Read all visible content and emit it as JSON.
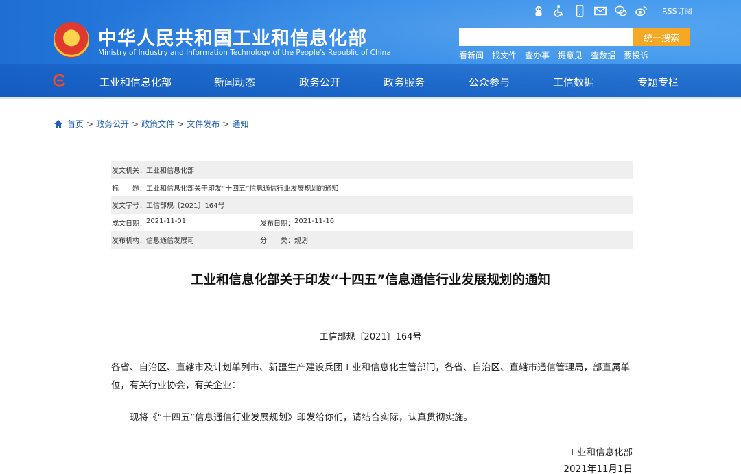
{
  "header": {
    "title": "中华人民共和国工业和信息化部",
    "subtitle": "Ministry of Industry and Information Technology of the People's Republic of China",
    "rss_label": "RSS订阅",
    "icons": [
      "robot-icon",
      "accessibility-icon",
      "mobile-icon",
      "mail-icon",
      "wechat-icon",
      "weibo-icon"
    ],
    "search": {
      "placeholder": "",
      "button_label": "统一搜索"
    },
    "quick_links": [
      "看新闻",
      "找文件",
      "查办事",
      "提意见",
      "查数据",
      "要投诉"
    ],
    "nav": [
      "工业和信息化部",
      "新闻动态",
      "政务公开",
      "政务服务",
      "公众参与",
      "工信数据",
      "专题专栏"
    ],
    "colors": {
      "header_blue": "#2b86e6",
      "search_button": "#f4a824"
    }
  },
  "breadcrumb": [
    "首页",
    "政务公开",
    "政策文件",
    "文件发布",
    "通知"
  ],
  "info": {
    "issuer_label": "发文机关：",
    "issuer": "工业和信息化部",
    "title_label": "标　　题：",
    "title": "工业和信息化部关于印发“十四五”信息通信行业发展规划的通知",
    "docno_label": "发文字号：",
    "docno": "工信部规〔2021〕164号",
    "created_label": "成文日期：",
    "created": "2021-11-01",
    "published_label": "发布日期：",
    "published": "2021-11-16",
    "agency_label": "发布机构：",
    "agency": "信息通信发展司",
    "category_label": "分　　类：",
    "category": "规划"
  },
  "article": {
    "title": "工业和信息化部关于印发“十四五”信息通信行业发展规划的通知",
    "docno": "工信部规〔2021〕164号",
    "para1": "各省、自治区、直辖市及计划单列市、新疆生产建设兵团工业和信息化主管部门，各省、自治区、直辖市通信管理局，部直属单位，有关行业协会，有关企业：",
    "para2": "现将《“十四五”信息通信行业发展规划》印发给你们，请结合实际，认真贯彻实施。",
    "signature": "工业和信息化部",
    "date": "2021年11月1日"
  }
}
